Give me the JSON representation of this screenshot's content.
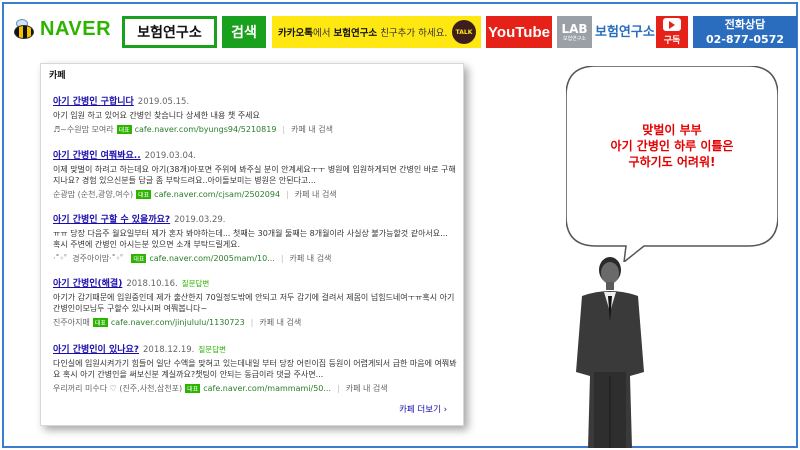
{
  "header": {
    "logo_text": "NAVER",
    "search_query": "보험연구소",
    "search_button": "검색",
    "kakao_pre": "카카오톡",
    "kakao_mid": "에서 ",
    "kakao_name": "보험연구소",
    "kakao_post": " 친구추가 하세요.",
    "kakao_icon": "TALK",
    "youtube_label": "YouTube",
    "lab_label": "LAB",
    "lab_sub": "보험연구소",
    "lab_name": "보험연구소",
    "subscribe_label": "구독",
    "phone_label": "전화상담",
    "phone_number": "02-877-0572"
  },
  "card": {
    "title": "카페",
    "more_link": "카페 더보기 ›",
    "results": [
      {
        "title": "아기 간병인 구합니다",
        "date": "2019.05.15.",
        "tag": "",
        "snippet": "아기 입원 하고 있어요 간병인 찾습니다 상세한 내용 챗 주세요",
        "author": "♬~수원맘 모여라",
        "badge": "대표",
        "url": "cafe.naver.com/byungs94/5210819",
        "action": "카페 내 검색"
      },
      {
        "title": "아기 간병인 여쭤봐요..",
        "date": "2019.03.04.",
        "tag": "",
        "snippet": "이제 맞벌이 하려고 하는데요 아기(38개)아포면 주위에 봐주실 분이 안계세요ㅜㅜ 병원에 입원하게되면 간병인 바로 구해지나요? 경험 있으신분들 답글 좀 부탁드려요..아이돌보미는 병원은 안된다고...",
        "author": "순광맘 (순천,광양,여수)",
        "badge": "대표",
        "url": "cafe.naver.com/cjsam/2502094",
        "action": "카페 내 검색"
      },
      {
        "title": "아기 간병인 구할 수 있을까요?",
        "date": "2019.03.29.",
        "tag": "",
        "snippet": "ㅠㅠ 당장 다음주 월요일부터 제가 혼자 봐야하는데... 첫째는 30개월 둘째는 8개월이라 사실상 불가능할것 같아서요... 혹시 주변에 간병인 아시는분 있으면 소개 부탁드릴게요.",
        "author": "·˚◦゜경주아이맘·˚◦゜",
        "badge": "대표",
        "url": "cafe.naver.com/2005mam/10...",
        "action": "카페 내 검색"
      },
      {
        "title": "아기 간병인(해결)",
        "date": "2018.10.16.",
        "tag": "질문답변",
        "snippet": "아기가 감기때문에 입원중인데 제가 출산한지 70일정도밖에 안되고 저두 감기에 걸려서 제몸이 넘힘드네여ㅜㅠ혹시 아기 간병인이모님두 구할수 있나시퍼 여쭤봅니다~",
        "author": "진주아지매",
        "badge": "대표",
        "url": "cafe.naver.com/jinjululu/1130723",
        "action": "카페 내 검색"
      },
      {
        "title": "아기 간병인이 있나요?",
        "date": "2018.12.19.",
        "tag": "질문답변",
        "snippet": "다인실에 입원시켜가기 힘들어 일단 수액을 맞혀고 있는데내일 부터 당장 어린이집 등원이 어렵게되서 급한 마음에 여쭤봐요 혹시 아기 간병인을 써보신분 계실까요?챗팅이 안되는 동급이라 댓글 주사면...",
        "author": "우리꺼리 미수다 ♡ (진주,사천,삼천포)",
        "badge": "대표",
        "url": "cafe.naver.com/mammami/50...",
        "action": "카페 내 검색"
      }
    ]
  },
  "bubble": {
    "line1": "맞벌이 부부",
    "line2": "아기 간병인 하루 이틀은",
    "line3": "구하기도 어려워!"
  },
  "colors": {
    "naver_green": "#2db400",
    "kakao_yellow": "#ffe812",
    "youtube_red": "#e62117",
    "phone_blue": "#2a6dbf",
    "bubble_text": "#e40000",
    "frame_blue": "#3d7dd0"
  }
}
